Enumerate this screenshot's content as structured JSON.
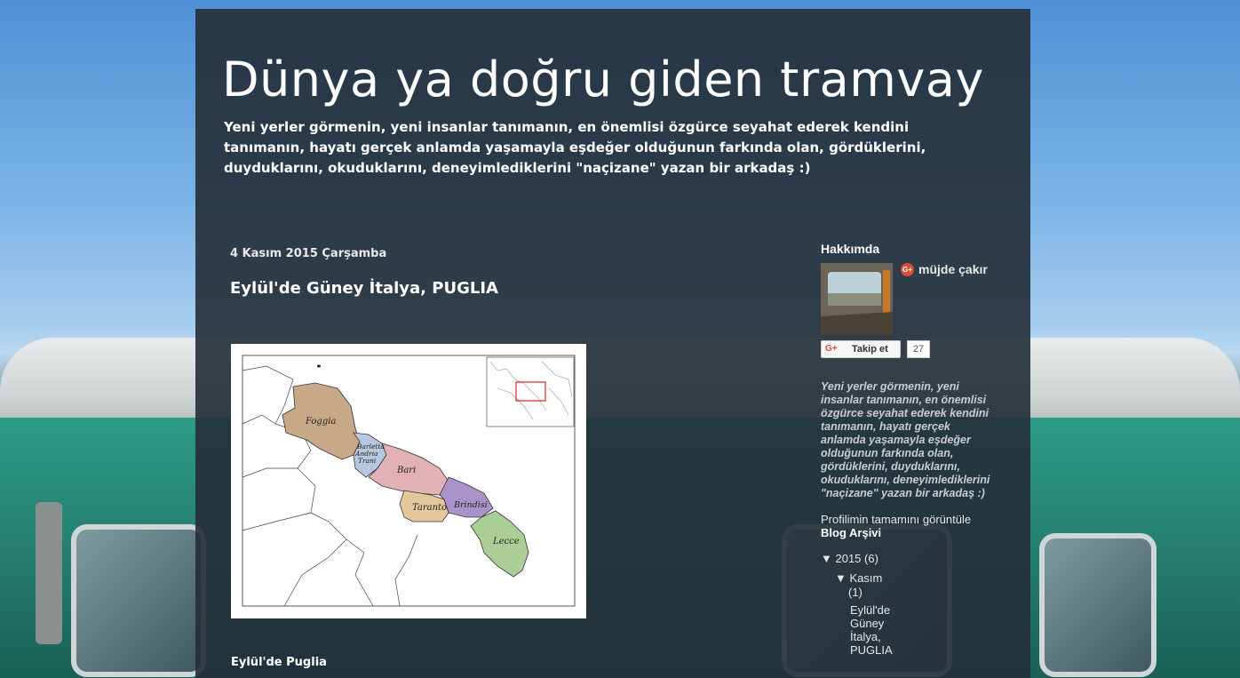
{
  "blog": {
    "title": "Dünya ya doğru giden tramvay",
    "description": "Yeni yerler görmenin, yeni insanlar tanımanın, en önemlisi özgürce seyahat ederek kendini tanımanın, hayatı gerçek anlamda yaşamayla eşdeğer olduğunun farkında olan, gördüklerini, duyduklarını, okuduklarını, deneyimlediklerini \"naçizane\" yazan bir arkadaş :)"
  },
  "post": {
    "date": "4 Kasım 2015 Çarşamba",
    "title": "Eylül'de Güney İtalya, PUGLIA",
    "snippet": "Eylül'de Puglia",
    "map_labels": {
      "foggia": "Foggia",
      "barletta": "Barletta",
      "andria": "Andria",
      "trani": "Trani",
      "bari": "Bari",
      "taranto": "Taranto",
      "brindisi": "Brindisi",
      "lecce": "Lecce"
    },
    "map_colors": {
      "foggia": "#c8a987",
      "bat": "#b7c7de",
      "bari": "#e2b1b6",
      "taranto": "#e5c79c",
      "brindisi": "#a993c9",
      "lecce": "#a9cf96"
    }
  },
  "sidebar": {
    "about_heading": "Hakkımda",
    "profile_name": "müjde çakır",
    "follow_label": "Takip et",
    "follow_count": "27",
    "about_text": "Yeni yerler görmenin, yeni insanlar tanımanın, en önemlisi özgürce seyahat ederek kendini tanımanın, hayatı gerçek anlamda yaşamayla eşdeğer olduğunun farkında olan, gördüklerini, duyduklarını, okuduklarını, deneyimlediklerini \"naçizane\" yazan bir arkadaş :)",
    "profile_link": "Profilimin tamamını görüntüle",
    "archive_heading": "Blog Arşivi",
    "archive": {
      "year": "▼  2015  (6)",
      "month": "▼  Kasım",
      "month_count": "(1)",
      "post": "Eylül'de Güney İtalya, PUGLIA"
    }
  }
}
